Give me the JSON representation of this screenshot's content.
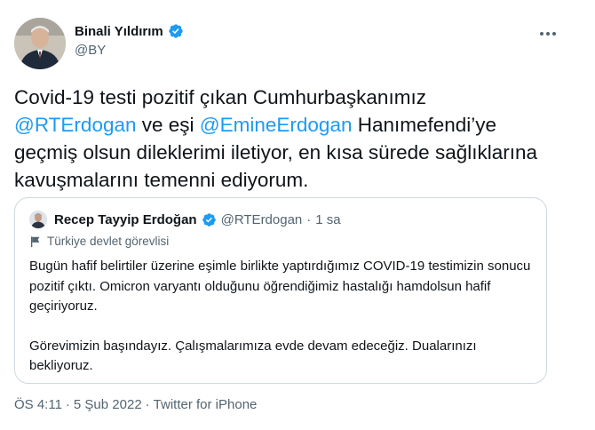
{
  "author": {
    "name": "Binali Yıldırım",
    "handle": "@BY",
    "verified": true
  },
  "tweet": {
    "text_part1": "Covid-19 testi pozitif çıkan Cumhurbaşkanımız ",
    "mention1": "@RTErdogan",
    "text_part2": " ve eşi ",
    "mention2": "@EmineErdogan",
    "text_part3": " Hanımefendi’ye geçmiş olsun dileklerimi iletiyor, en kısa sürede sağlıklarına kavuşmalarını temenni ediyorum."
  },
  "quoted": {
    "name": "Recep Tayyip Erdoğan",
    "handle": "@RTErdogan",
    "separator": "·",
    "time": "1 sa",
    "label": "Türkiye devlet görevlisi",
    "paragraph1": "Bugün hafif belirtiler üzerine eşimle birlikte yaptırdığımız COVID-19 testimizin sonucu pozitif çıktı. Omicron varyantı olduğunu öğrendiğimiz hastalığı hamdolsun hafif geçiriyoruz.",
    "paragraph2": "Görevimizin başındayız. Çalışmalarımıza evde devam edeceğiz. Dualarınızı bekliyoruz."
  },
  "meta": {
    "time": "ÖS 4:11",
    "sep1": "·",
    "date": "5 Şub 2022",
    "sep2": "·",
    "source": "Twitter for iPhone"
  },
  "colors": {
    "accent": "#1d9bf0",
    "text": "#0f1419",
    "secondary": "#536471",
    "border": "#cfd9de"
  },
  "icons": {
    "verified": "verified-badge-icon",
    "more": "more-options-icon",
    "label": "flag-icon"
  }
}
